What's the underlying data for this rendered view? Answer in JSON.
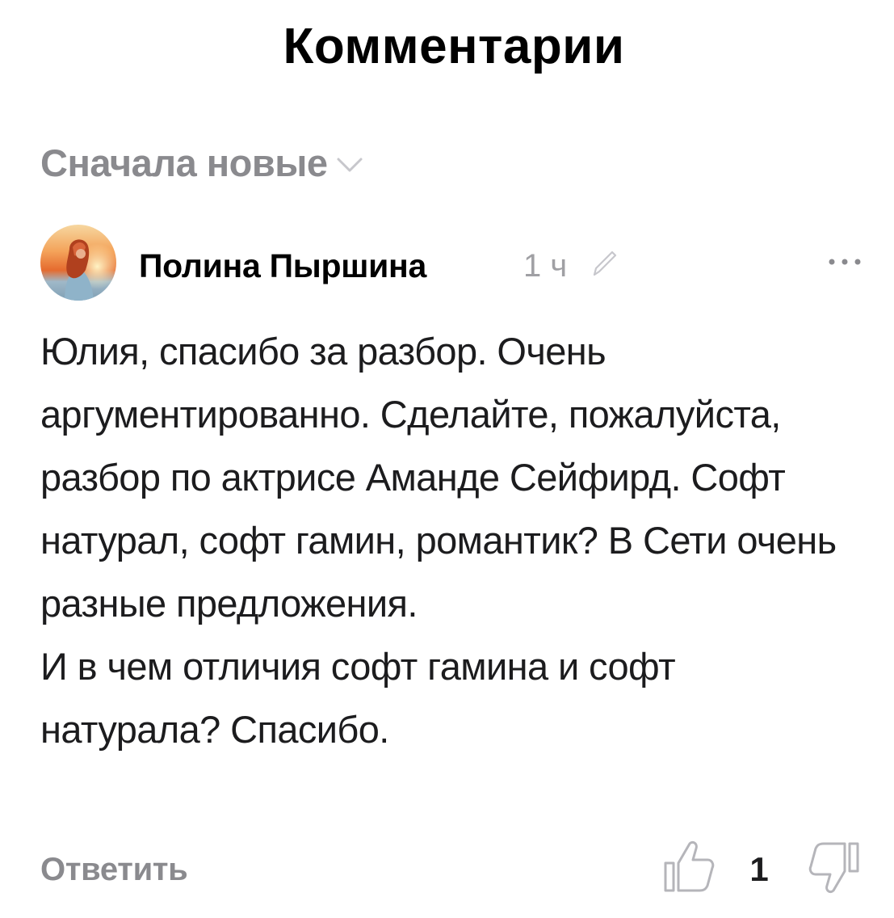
{
  "header": {
    "title": "Комментарии"
  },
  "sort": {
    "label": "Сначала новые",
    "icon": "chevron-down-icon"
  },
  "comment": {
    "author": "Полина Пыршина",
    "time": "1 ч",
    "text": "Юлия, спасибо за разбор. Очень аргументированно. Сделайте, пожалуйста, разбор по актрисе Аманде Сейфирд. Софт натурал, софт гамин, романтик? В Сети очень разные предложения.\nИ в чем отличия софт гамина и софт натурала? Спасибо.",
    "reply_label": "Ответить",
    "likes": "1",
    "icons": {
      "edited": "pencil-icon",
      "more": "more-dots-icon",
      "like": "thumbs-up-icon",
      "dislike": "thumbs-down-icon"
    }
  },
  "colors": {
    "text_primary": "#1c1c1e",
    "text_secondary": "#8a8a8e",
    "time": "#a0a0a4",
    "icon_muted": "#b5b5ba",
    "background": "#ffffff"
  }
}
